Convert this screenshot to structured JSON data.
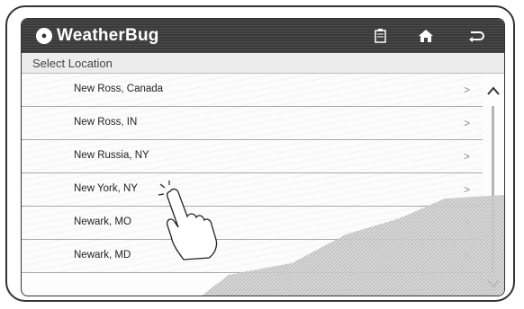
{
  "header": {
    "app_name": "WeatherBug",
    "icons": [
      "weatherbug-logo",
      "note-icon",
      "home-icon",
      "back-icon"
    ]
  },
  "list_title": "Select Location",
  "locations": [
    {
      "label": "New Ross, Canada"
    },
    {
      "label": "New Ross, IN"
    },
    {
      "label": "New Russia, NY"
    },
    {
      "label": "New York, NY"
    },
    {
      "label": "Newark, MO"
    },
    {
      "label": "Newark, MD"
    }
  ],
  "colors": {
    "header_bg": "#3a3a3a",
    "accent_hill": "#c8c8c8"
  }
}
